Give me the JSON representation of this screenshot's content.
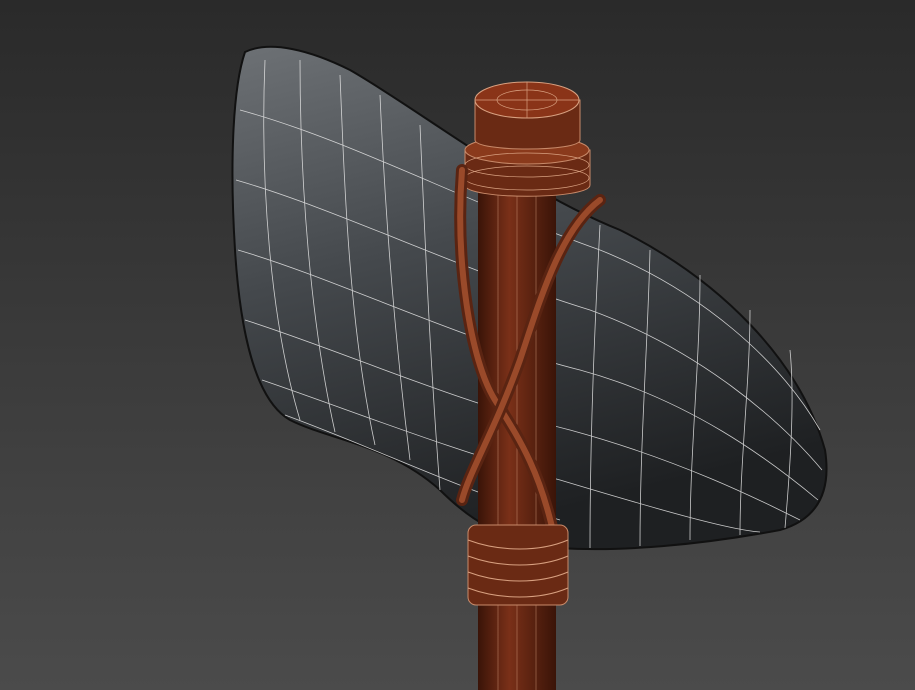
{
  "viewport": {
    "colors": {
      "background_top": "#2a2a2a",
      "background_bottom": "#4b4b4b",
      "stone_light": "#6a6e72",
      "stone_dark": "#1c1e20",
      "wood": "#6a2a14",
      "wood_light": "#9a4a2a",
      "wire": "#e8e8e8"
    }
  }
}
